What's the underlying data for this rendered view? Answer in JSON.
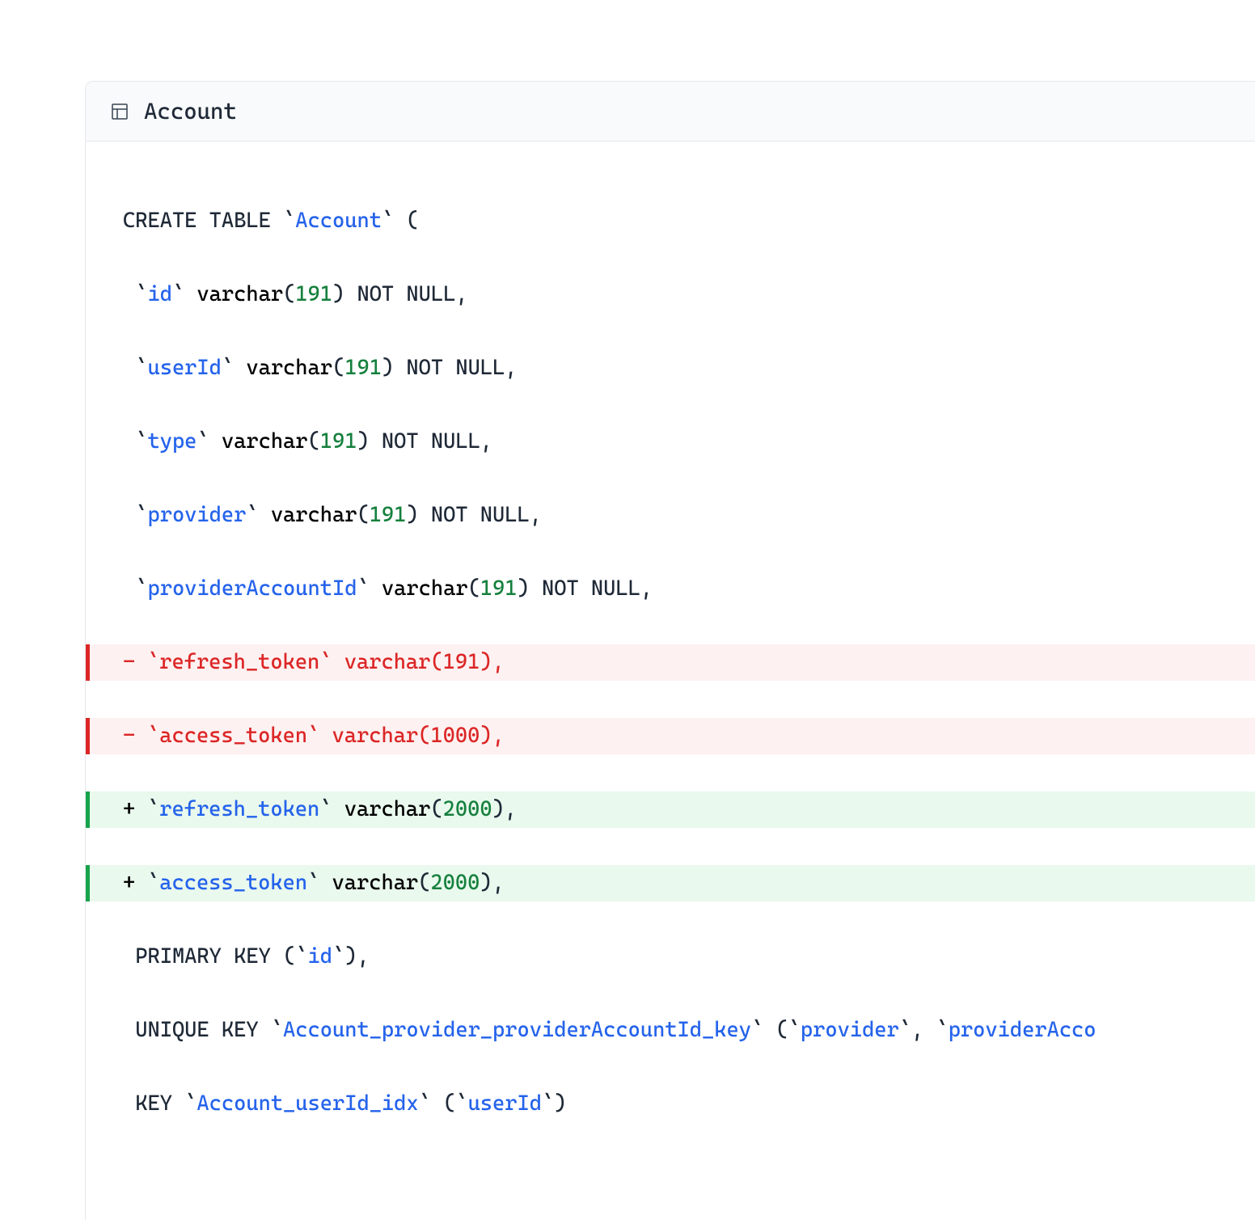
{
  "header": {
    "title": "Account"
  },
  "sql": {
    "create": "CREATE TABLE",
    "tableName": "Account",
    "columns": {
      "id": {
        "name": "id",
        "type": "varchar",
        "size": "191",
        "constraint": "NOT NULL"
      },
      "userId": {
        "name": "userId",
        "type": "varchar",
        "size": "191",
        "constraint": "NOT NULL"
      },
      "type": {
        "name": "type",
        "type": "varchar",
        "size": "191",
        "constraint": "NOT NULL"
      },
      "provider": {
        "name": "provider",
        "type": "varchar",
        "size": "191",
        "constraint": "NOT NULL"
      },
      "providerAccountId": {
        "name": "providerAccountId",
        "type": "varchar",
        "size": "191",
        "constraint": "NOT NULL"
      },
      "refresh_token_old": {
        "name": "refresh_token",
        "type": "varchar",
        "size": "191"
      },
      "access_token_old": {
        "name": "access_token",
        "type": "varchar",
        "size": "1000"
      },
      "refresh_token_new": {
        "name": "refresh_token",
        "type": "varchar",
        "size": "2000"
      },
      "access_token_new": {
        "name": "access_token",
        "type": "varchar",
        "size": "2000"
      }
    },
    "keys": {
      "primary": {
        "label": "PRIMARY KEY",
        "col": "id"
      },
      "unique": {
        "label": "UNIQUE KEY",
        "name": "Account_provider_providerAccountId_key",
        "col1": "provider",
        "col2": "providerAcco"
      },
      "index": {
        "label": "KEY",
        "name": "Account_userId_idx",
        "col": "userId"
      }
    },
    "varchar": "varchar",
    "notNull": "NOT NULL"
  },
  "diff": {
    "minus": "-",
    "plus": "+"
  }
}
